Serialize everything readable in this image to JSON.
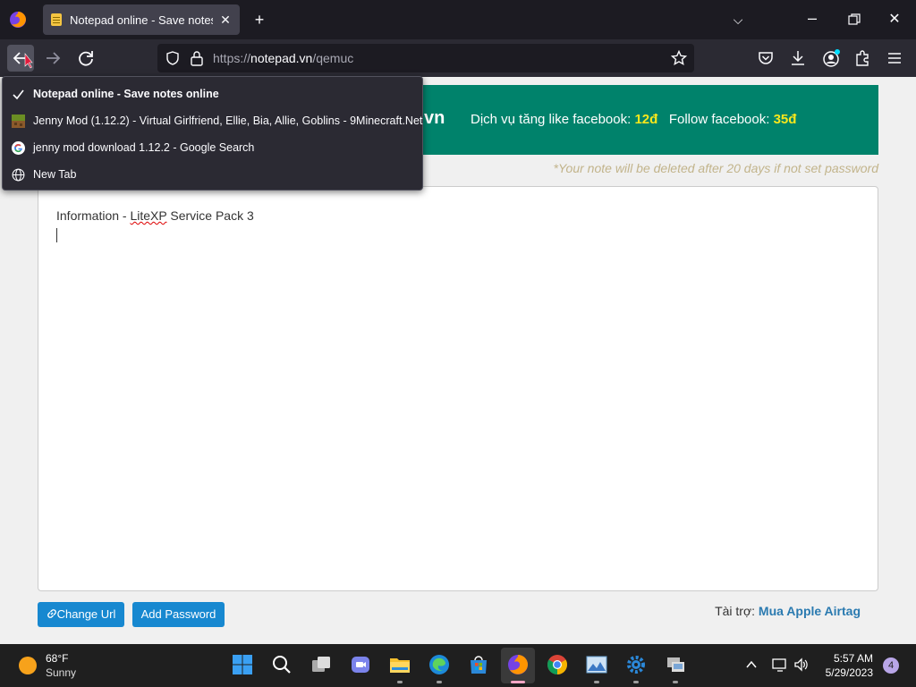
{
  "browser": {
    "tab_title": "Notepad online - Save notes online",
    "url_prefix": "https://",
    "url_domain": "notepad.vn",
    "url_path": "/qemuc",
    "history_dropdown": [
      {
        "label": "Notepad online - Save notes online",
        "icon": "check-icon",
        "active": true
      },
      {
        "label": "Jenny Mod (1.12.2) - Virtual Girlfriend, Ellie, Bia, Allie, Goblins - 9Minecraft.Net",
        "icon": "minecraft-favicon",
        "active": false
      },
      {
        "label": "jenny mod download 1.12.2 - Google Search",
        "icon": "google-favicon",
        "active": false
      },
      {
        "label": "New Tab",
        "icon": "globe-icon",
        "active": false
      }
    ]
  },
  "page": {
    "banner_fragment": "vn",
    "banner_service": "Dịch vụ tăng like facebook:",
    "banner_price1": "12đ",
    "banner_follow": "Follow facebook:",
    "banner_price2": "35đ",
    "note_hint": "*Your note will be deleted after 20 days if not set password",
    "editor_text_part1": "Information - ",
    "editor_text_misspelled": "LiteXP",
    "editor_text_part2": " Service Pack 3",
    "change_url_label": "Change Url",
    "add_password_label": "Add Password",
    "sponsor_label": "Tài trợ:",
    "sponsor_link": "Mua Apple Airtag"
  },
  "taskbar": {
    "weather_temp": "68°F",
    "weather_desc": "Sunny",
    "time": "5:57 AM",
    "date": "5/29/2023",
    "notification_count": "4"
  },
  "colors": {
    "banner_bg": "#00826b",
    "banner_highlight": "#f8e71c",
    "button_bg": "#1788d0"
  }
}
